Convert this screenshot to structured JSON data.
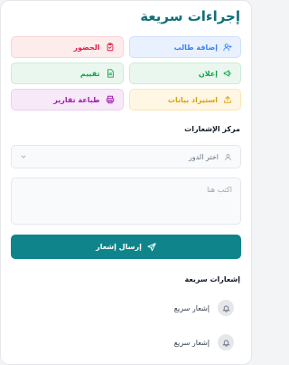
{
  "title": "إجراءات سريعة",
  "actions": [
    {
      "label": "إضافة طالب",
      "icon": "user-plus-icon",
      "color": "#3b82f6"
    },
    {
      "label": "الحضور",
      "icon": "clipboard-check-icon",
      "color": "#e11d48"
    },
    {
      "label": "إعلان",
      "icon": "megaphone-icon",
      "color": "#16a34a"
    },
    {
      "label": "تقييم",
      "icon": "document-icon",
      "color": "#16a34a"
    },
    {
      "label": "استيراد بيانات",
      "icon": "upload-icon",
      "color": "#d9a10a"
    },
    {
      "label": "طباعة تقارير",
      "icon": "printer-icon",
      "color": "#a21caf"
    }
  ],
  "notifications_center": {
    "label": "مركز الإشعارات",
    "role_select": {
      "value": "اختر الدور"
    },
    "message": {
      "placeholder": "اكتب هنا"
    },
    "send_label": "إرسال إشعار"
  },
  "quick_notifications": {
    "label": "إشعارات سريعة",
    "items": [
      {
        "label": "إشعار سريع",
        "icon": "bell-icon"
      },
      {
        "label": "إشعار سريع",
        "icon": "bell-icon"
      }
    ]
  },
  "colors": {
    "accent": "#0f858b",
    "title": "#0f6f78"
  }
}
